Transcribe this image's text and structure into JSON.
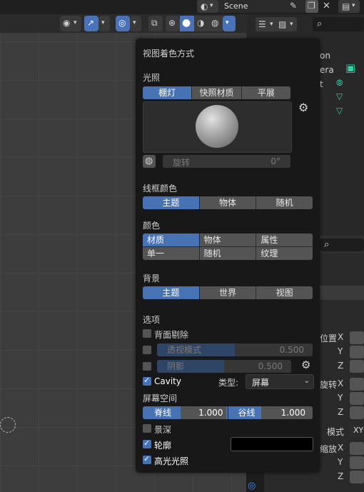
{
  "topbar": {
    "scene_label": "Scene"
  },
  "popup": {
    "title": "视图着色方式",
    "lighting": {
      "heading": "光照",
      "options": [
        "棚灯",
        "快照材质",
        "平展"
      ],
      "selected": 0,
      "rotation_label": "旋转",
      "rotation_value": "0°"
    },
    "wire_color": {
      "heading": "线框颜色",
      "options": [
        "主题",
        "物体",
        "随机"
      ],
      "selected": 0
    },
    "color": {
      "heading": "颜色",
      "options": [
        "材质",
        "物体",
        "属性",
        "单一",
        "随机",
        "纹理"
      ],
      "selected": 0
    },
    "background": {
      "heading": "背景",
      "options": [
        "主题",
        "世界",
        "视图"
      ],
      "selected": 0
    },
    "options": {
      "heading": "选项",
      "backface_culling": {
        "label": "背面剔除",
        "checked": false
      },
      "xray": {
        "label": "透视模式",
        "value": "0.500",
        "checked": false,
        "fraction": 0.5
      },
      "shadow": {
        "label": "阴影",
        "value": "0.500",
        "checked": false,
        "fraction": 0.5
      },
      "cavity": {
        "label": "Cavity",
        "checked": true,
        "type_label": "类型:",
        "type_value": "屏幕"
      },
      "screen_space": {
        "heading": "屏幕空间",
        "ridge_label": "脊线",
        "ridge_value": "1.000",
        "valley_label": "谷线",
        "valley_value": "1.000"
      },
      "dof": {
        "label": "景深",
        "checked": false
      },
      "outline": {
        "label": "轮廓",
        "checked": true,
        "color": "#000000"
      },
      "specular": {
        "label": "高光光照",
        "checked": true
      }
    }
  },
  "outliner": {
    "items": [
      "on",
      "era",
      "t"
    ]
  },
  "properties": {
    "location_label": "位置",
    "rotation_label": "旋转",
    "mode_label": "模式",
    "mode_value": "XY",
    "scale_label": "缩放",
    "axes": [
      "X",
      "Y",
      "Z"
    ]
  },
  "colors": {
    "accent": "#4772b3",
    "popup_bg": "#181818",
    "field": "#545454"
  }
}
